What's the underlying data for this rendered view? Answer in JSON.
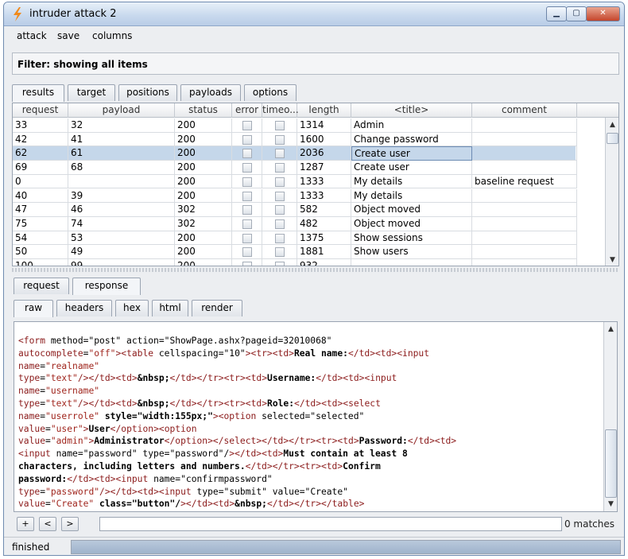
{
  "window": {
    "title": "intruder attack 2"
  },
  "menu": [
    "attack",
    "save",
    "columns"
  ],
  "filter": {
    "label": "Filter:",
    "text": "showing all items"
  },
  "main_tabs": [
    "results",
    "target",
    "positions",
    "payloads",
    "options"
  ],
  "table": {
    "columns": [
      "request",
      "payload",
      "status",
      "error",
      "timeo...",
      "length",
      "<title>",
      "comment"
    ],
    "rows": [
      {
        "request": "33",
        "payload": "32",
        "status": "200",
        "length": "1314",
        "title": "Admin",
        "comment": ""
      },
      {
        "request": "42",
        "payload": "41",
        "status": "200",
        "length": "1600",
        "title": "Change password",
        "comment": ""
      },
      {
        "request": "62",
        "payload": "61",
        "status": "200",
        "length": "2036",
        "title": "Create user",
        "comment": "",
        "selected": true
      },
      {
        "request": "69",
        "payload": "68",
        "status": "200",
        "length": "1287",
        "title": "Create user",
        "comment": ""
      },
      {
        "request": "0",
        "payload": "",
        "status": "200",
        "length": "1333",
        "title": "My details",
        "comment": "baseline request"
      },
      {
        "request": "40",
        "payload": "39",
        "status": "200",
        "length": "1333",
        "title": "My details",
        "comment": ""
      },
      {
        "request": "47",
        "payload": "46",
        "status": "302",
        "length": "582",
        "title": "Object moved",
        "comment": ""
      },
      {
        "request": "75",
        "payload": "74",
        "status": "302",
        "length": "482",
        "title": "Object moved",
        "comment": ""
      },
      {
        "request": "54",
        "payload": "53",
        "status": "200",
        "length": "1375",
        "title": "Show sessions",
        "comment": ""
      },
      {
        "request": "50",
        "payload": "49",
        "status": "200",
        "length": "1881",
        "title": "Show users",
        "comment": ""
      },
      {
        "request": "100",
        "payload": "99",
        "status": "200",
        "length": "932",
        "title": "",
        "comment": ""
      }
    ]
  },
  "detail_tabs": [
    "request",
    "response"
  ],
  "view_tabs": [
    "raw",
    "headers",
    "hex",
    "html",
    "render"
  ],
  "response_code": [
    "<form method=\"post\" action=\"ShowPage.ashx?pageid=32010068\"",
    "autocomplete=\"off\"><table cellspacing=\"10\"><tr><td>Real name:</td><td><input",
    "name=\"realname\"",
    "type=\"text\"/></td><td>&nbsp;</td></tr><tr><td>Username:</td><td><input",
    "name=\"username\"",
    "type=\"text\"/></td><td>&nbsp;</td></tr><tr><td>Role:</td><td><select",
    "name=\"userrole\" style=\"width:155px;\"><option selected=\"selected\"",
    "value=\"user\">User</option><option",
    "value=\"admin\">Administrator</option></select></td></tr><tr><td>Password:</td><td>",
    "<input name=\"password\" type=\"password\"/></td><td>Must contain at least 8",
    "characters, including letters and numbers.</td></tr><tr><td>Confirm",
    "password:</td><td><input name=\"confirmpassword\"",
    "type=\"password\"/></td><td><input type=\"submit\" value=\"Create\"",
    "value=\"Create\" class=\"button\"/></td><td>&nbsp;</td></tr></table>"
  ],
  "search": {
    "plus": "+",
    "prev": "<",
    "next": ">",
    "value": "",
    "matches": "0 matches"
  },
  "status": {
    "text": "finished"
  }
}
